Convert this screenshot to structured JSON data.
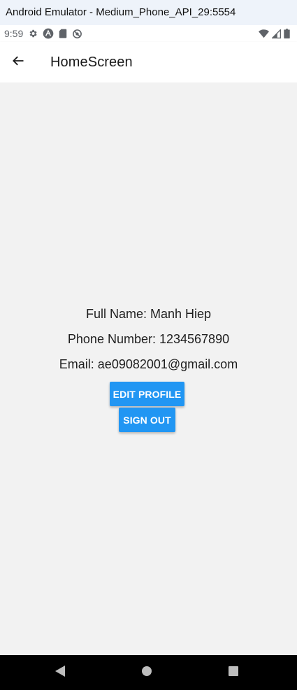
{
  "window": {
    "title": "Android Emulator - Medium_Phone_API_29:5554"
  },
  "status_bar": {
    "time": "9:59",
    "left_icons": [
      "settings-icon",
      "arch-icon",
      "sd-card-icon",
      "sync-off-icon"
    ],
    "right_icons": [
      "wifi-icon",
      "signal-icon",
      "battery-icon"
    ]
  },
  "app_bar": {
    "title": "HomeScreen",
    "back_icon": "arrow-back-icon"
  },
  "profile": {
    "full_name": "Full Name: Manh Hiep",
    "phone": "Phone Number: 1234567890",
    "email": "Email: ae09082001@gmail.com"
  },
  "buttons": {
    "edit_profile": "EDIT PROFILE",
    "sign_out": "SIGN OUT"
  },
  "nav_bar": {
    "icons": [
      "back-triangle-icon",
      "home-circle-icon",
      "recents-square-icon"
    ]
  },
  "colors": {
    "accent": "#2196f3",
    "background": "#f2f2f2",
    "app_bar": "#ffffff",
    "nav_bar": "#000000"
  }
}
